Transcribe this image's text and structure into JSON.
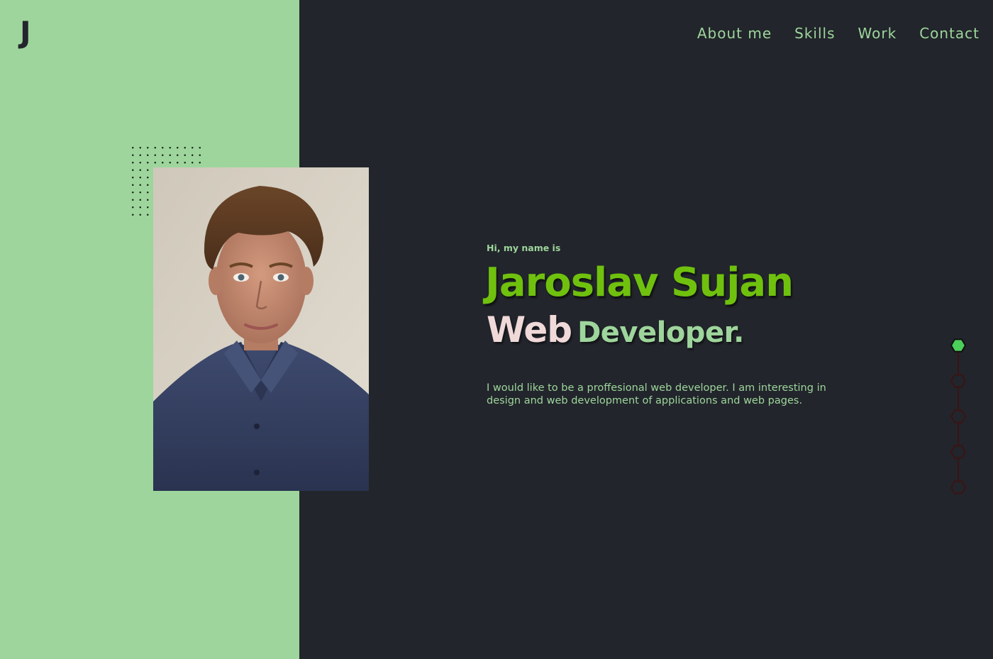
{
  "logo": {
    "text": "J"
  },
  "nav": {
    "items": [
      {
        "label": "About me"
      },
      {
        "label": "Skills"
      },
      {
        "label": "Work"
      },
      {
        "label": "Contact"
      }
    ]
  },
  "hero": {
    "greeting": "Hi, my name is",
    "name": "Jaroslav Sujan",
    "role_first": "Web",
    "role_second": "Developer.",
    "intro": "I would like to be a proffesional web developer. I am interesting in design and web development of applications and web pages."
  },
  "section_indicator": {
    "total": 5,
    "active_index": 0
  },
  "colors": {
    "accent_green": "#9ed59c",
    "name_green": "#6fc10e",
    "background_dark": "#22252b",
    "role_pink": "#f0d9d9",
    "indicator_active": "#4ccf5a",
    "indicator_inactive": "#3a1414"
  }
}
